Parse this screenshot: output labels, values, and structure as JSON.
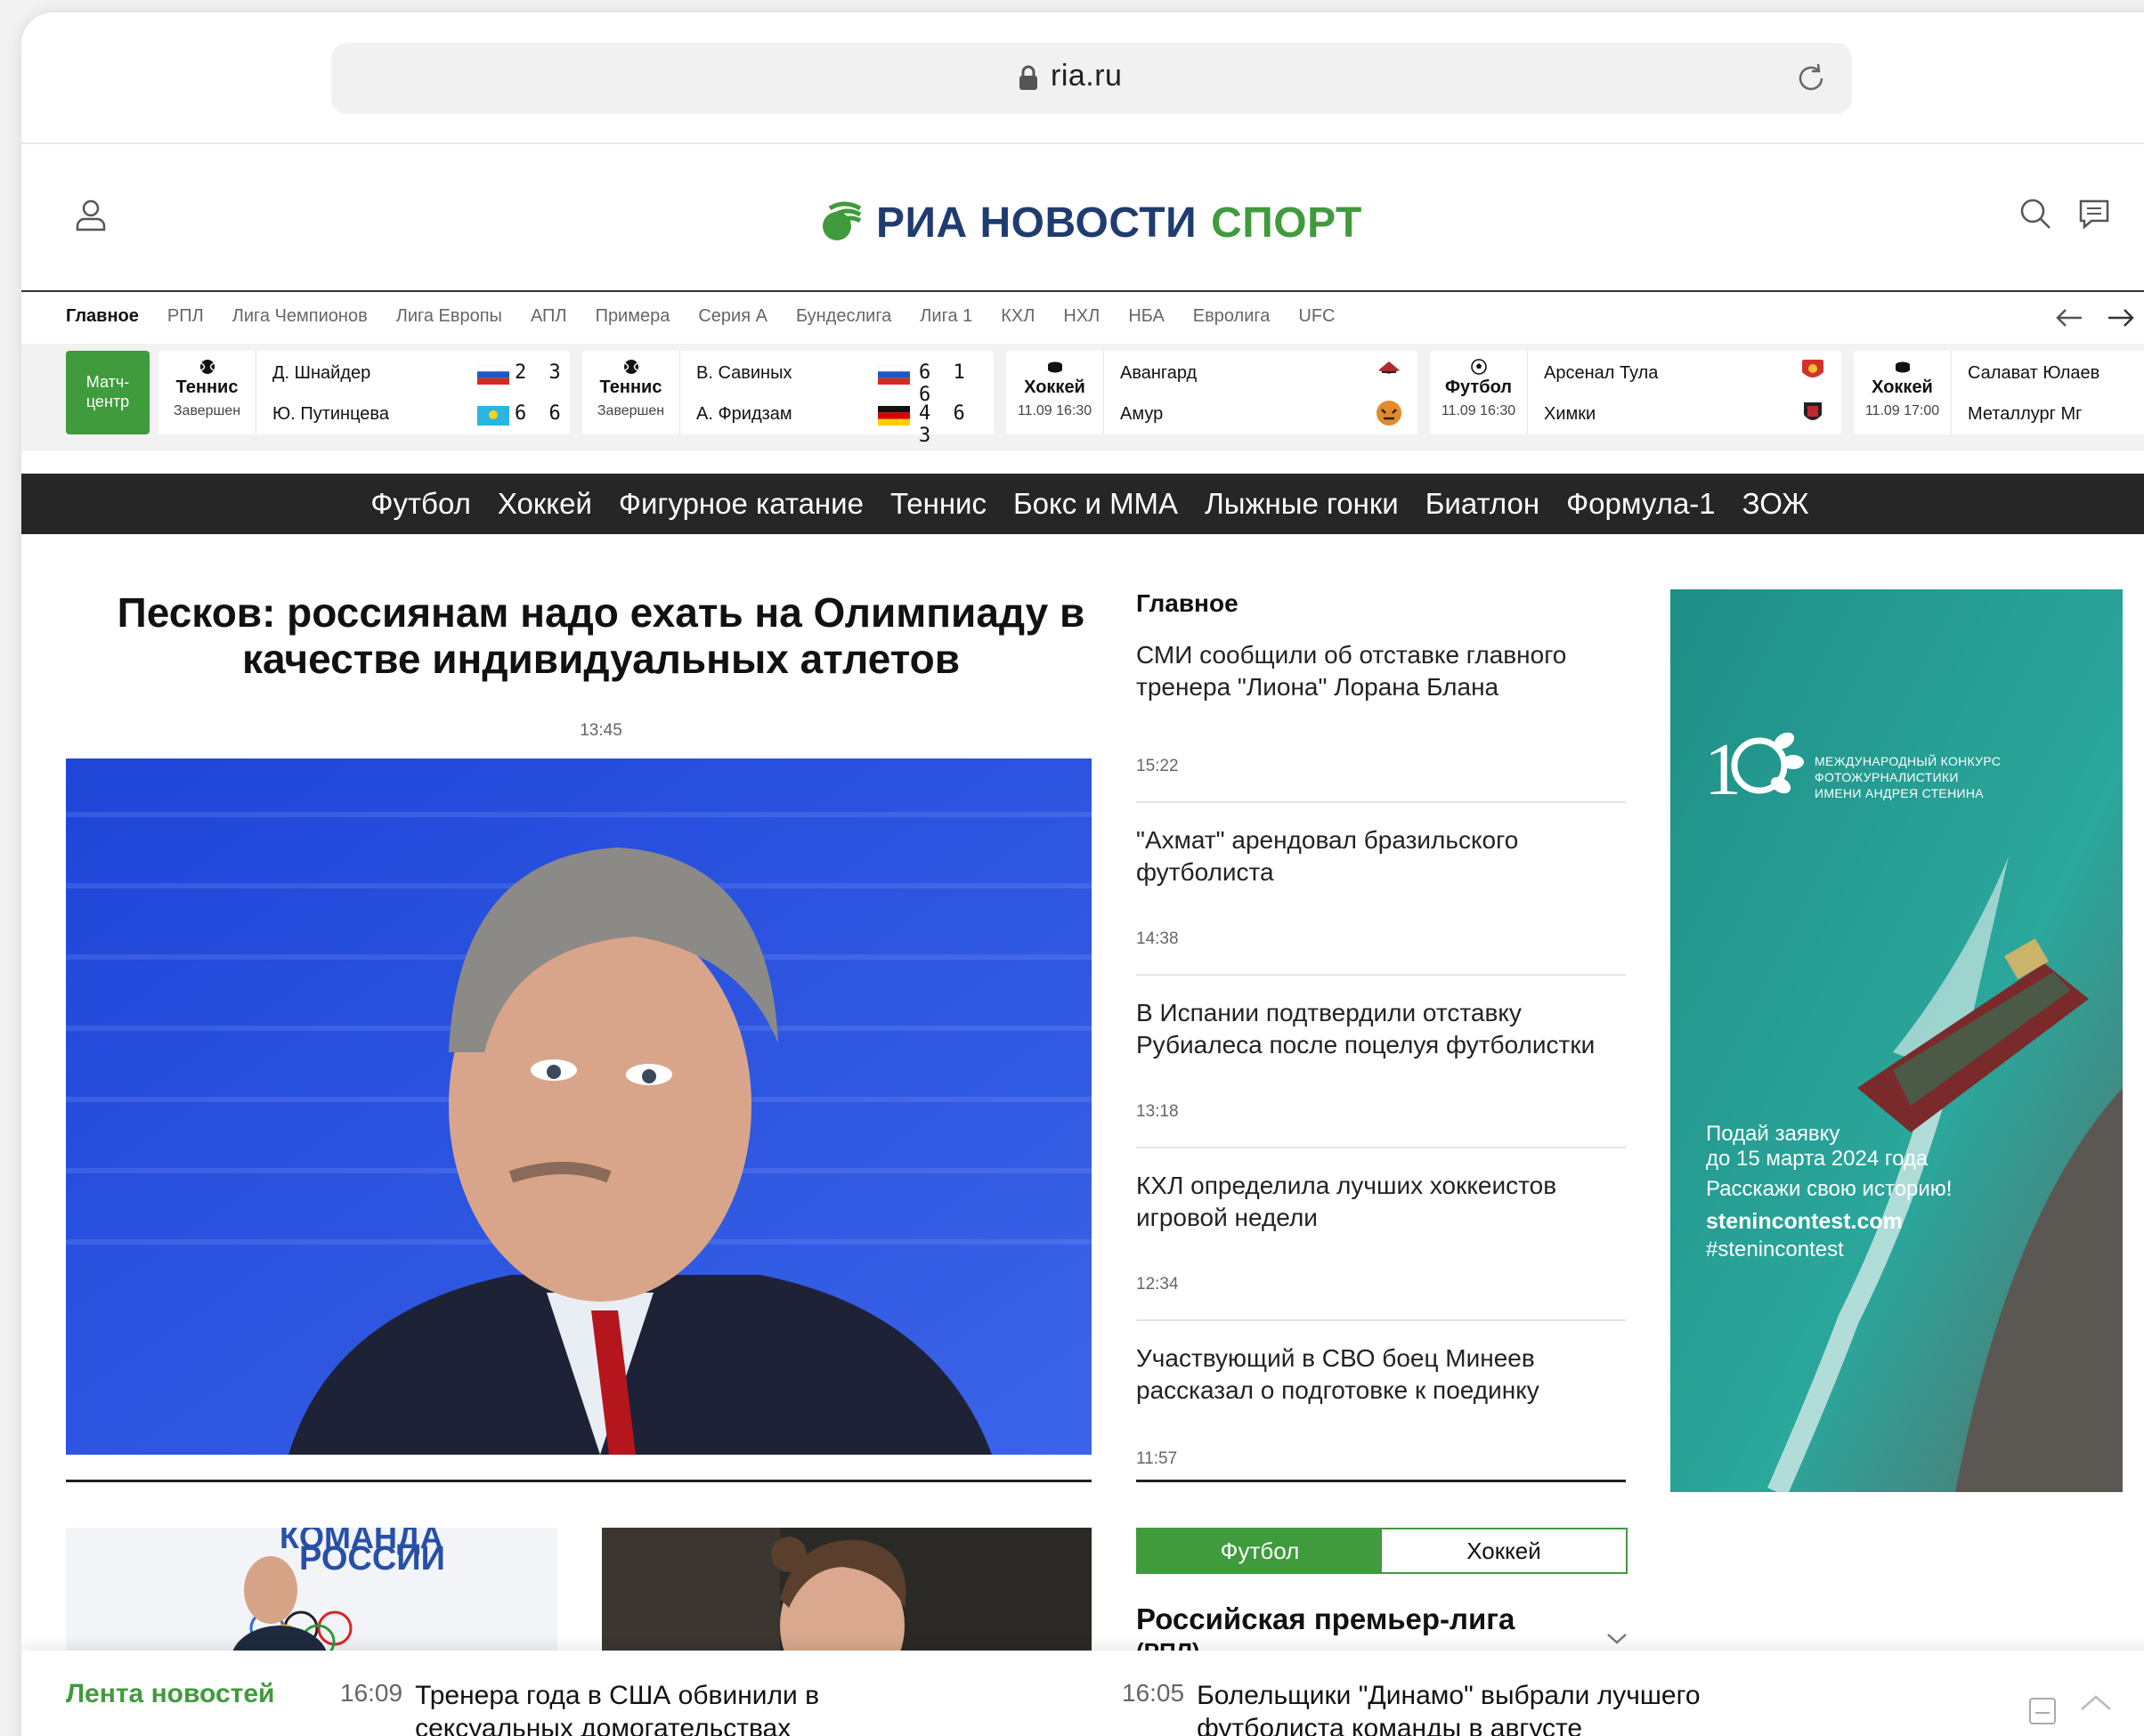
{
  "browser": {
    "url": "ria.ru"
  },
  "site": {
    "logo_main": "РИА НОВОСТИ",
    "logo_sport": "СПОРТ"
  },
  "league_nav": [
    {
      "label": "Главное",
      "active": true
    },
    {
      "label": "РПЛ"
    },
    {
      "label": "Лига Чемпионов"
    },
    {
      "label": "Лига Европы"
    },
    {
      "label": "АПЛ"
    },
    {
      "label": "Примера"
    },
    {
      "label": "Серия А"
    },
    {
      "label": "Бундеслига"
    },
    {
      "label": "Лига 1"
    },
    {
      "label": "КХЛ"
    },
    {
      "label": "НХЛ"
    },
    {
      "label": "НБА"
    },
    {
      "label": "Евролига"
    },
    {
      "label": "UFC"
    }
  ],
  "match_center": {
    "label": "Матч-центр"
  },
  "matches": [
    {
      "sport": "Теннис",
      "status": "Завершен",
      "team1": "Д. Шнайдер",
      "team2": "Ю. Путинцева",
      "score1": "2 3",
      "score2": "6 6"
    },
    {
      "sport": "Теннис",
      "status": "Завершен",
      "team1": "В. Савиных",
      "team2": "А. Фридзам",
      "score1": "6 1 6",
      "score2": "4 6 3"
    },
    {
      "sport": "Хоккей",
      "status": "11.09 16:30",
      "team1": "Авангард",
      "team2": "Амур"
    },
    {
      "sport": "Футбол",
      "status": "11.09 16:30",
      "team1": "Арсенал Тула",
      "team2": "Химки"
    },
    {
      "sport": "Хоккей",
      "status": "11.09 17:00",
      "team1": "Салават Юлаев",
      "team2": "Металлург Мг"
    }
  ],
  "sport_nav": [
    "Футбол",
    "Хоккей",
    "Фигурное катание",
    "Теннис",
    "Бокс и ММА",
    "Лыжные гонки",
    "Биатлон",
    "Формула-1",
    "ЗОЖ"
  ],
  "main_story": {
    "title": "Песков: россиянам надо ехать на Олимпиаду в качестве индивидуальных атлетов",
    "time": "13:45"
  },
  "thumb1": {
    "caption_top": "КОМАНДА",
    "caption": "РОССИИ"
  },
  "news": {
    "title": "Главное",
    "items": [
      {
        "text": "СМИ сообщили об отставке главного тренера \"Лиона\" Лорана Блана",
        "time": "15:22"
      },
      {
        "text": "\"Ахмат\" арендовал бразильского футболиста",
        "time": "14:38"
      },
      {
        "text": "В Испании подтвердили отставку Рубиалеса после поцелуя футболистки",
        "time": "13:18"
      },
      {
        "text": "КХЛ определила лучших хоккеистов игровой недели",
        "time": "12:34"
      },
      {
        "text": "Участвующий в СВО боец Минеев рассказал о подготовке к поединку",
        "time": "11:57"
      }
    ]
  },
  "tabs": [
    {
      "label": "Футбол",
      "active": true
    },
    {
      "label": "Хоккей"
    }
  ],
  "league_table": {
    "title": "Российская премьер-лига",
    "subtitle": "(РПЛ)"
  },
  "ad": {
    "contest_line1": "МЕЖДУНАРОДНЫЙ КОНКУРС",
    "contest_line2": "ФОТОЖУРНАЛИСТИКИ",
    "contest_line3": "ИМЕНИ АНДРЕЯ СТЕНИНА",
    "line1": "Подай заявку",
    "line2": "до 15 марта 2024 года",
    "line3": "Расскажи свою историю!",
    "site": "stenincontest.com",
    "hashtag": "#stenincontest"
  },
  "ticker": {
    "label": "Лента новостей",
    "items": [
      {
        "time": "16:09",
        "text": "Тренера года в США обвинили в сексуальных домогательствах"
      },
      {
        "time": "16:05",
        "text": "Болельщики \"Динамо\" выбрали лучшего футболиста команды в августе"
      }
    ]
  },
  "colors": {
    "brand_green": "#3f9b3c",
    "brand_blue": "#1f3c70",
    "dark_nav": "#262626"
  }
}
